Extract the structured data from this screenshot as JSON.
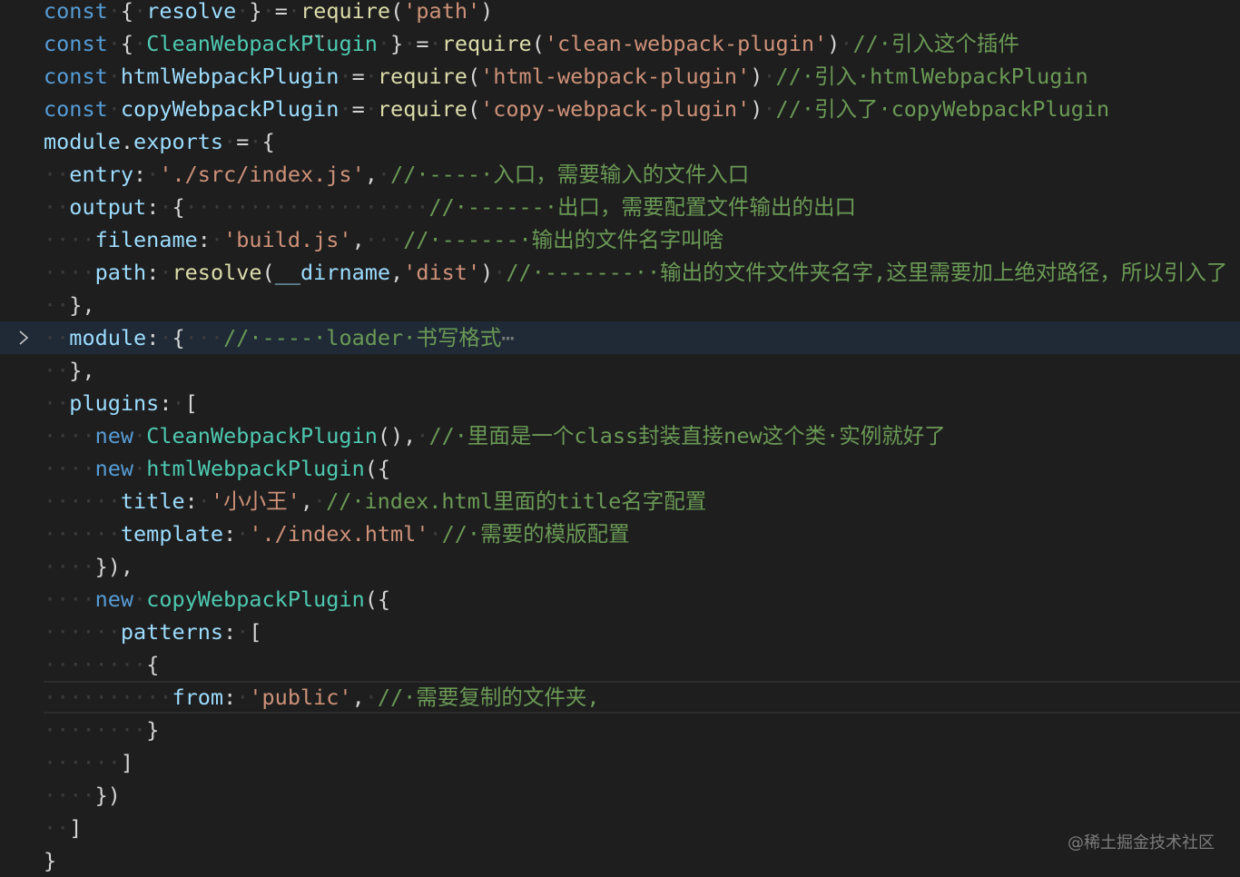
{
  "editor": {
    "lines": [
      [
        [
          "t-keyword",
          "const"
        ],
        [
          "t-ws",
          "·"
        ],
        [
          "t-punct",
          "{"
        ],
        [
          "t-ws",
          "·"
        ],
        [
          "t-var",
          "resolve"
        ],
        [
          "t-ws",
          "·"
        ],
        [
          "t-punct",
          "}"
        ],
        [
          "t-ws",
          "·"
        ],
        [
          "t-punct",
          "="
        ],
        [
          "t-ws",
          "·"
        ],
        [
          "t-func",
          "require"
        ],
        [
          "t-punct",
          "("
        ],
        [
          "t-string",
          "'path'"
        ],
        [
          "t-punct",
          ")"
        ]
      ],
      [
        [
          "t-keyword",
          "const"
        ],
        [
          "t-ws",
          "·"
        ],
        [
          "t-punct",
          "{"
        ],
        [
          "t-ws",
          "·"
        ],
        [
          "t-class",
          "CleanWebpackPlugin"
        ],
        [
          "t-ws",
          "·"
        ],
        [
          "t-punct",
          "}"
        ],
        [
          "t-ws",
          "·"
        ],
        [
          "t-punct",
          "="
        ],
        [
          "t-ws",
          "·"
        ],
        [
          "t-func",
          "require"
        ],
        [
          "t-punct",
          "("
        ],
        [
          "t-string",
          "'clean-webpack-plugin'"
        ],
        [
          "t-punct",
          ")"
        ],
        [
          "t-ws",
          "·"
        ],
        [
          "t-comment",
          "//·引入这个插件"
        ]
      ],
      [
        [
          "t-keyword",
          "const"
        ],
        [
          "t-ws",
          "·"
        ],
        [
          "t-var",
          "htmlWebpackPlugin"
        ],
        [
          "t-ws",
          "·"
        ],
        [
          "t-punct",
          "="
        ],
        [
          "t-ws",
          "·"
        ],
        [
          "t-func",
          "require"
        ],
        [
          "t-punct",
          "("
        ],
        [
          "t-string",
          "'html-webpack-plugin'"
        ],
        [
          "t-punct",
          ")"
        ],
        [
          "t-ws",
          "·"
        ],
        [
          "t-comment",
          "//·引入·htmlWebpackPlugin"
        ]
      ],
      [
        [
          "t-keyword",
          "const"
        ],
        [
          "t-ws",
          "·"
        ],
        [
          "t-var",
          "copyWebpackPlugin"
        ],
        [
          "t-ws",
          "·"
        ],
        [
          "t-punct",
          "="
        ],
        [
          "t-ws",
          "·"
        ],
        [
          "t-func",
          "require"
        ],
        [
          "t-punct",
          "("
        ],
        [
          "t-string",
          "'copy-webpack-plugin'"
        ],
        [
          "t-punct",
          ")"
        ],
        [
          "t-ws",
          "·"
        ],
        [
          "t-comment",
          "//·引入了·copyWebpackPlugin"
        ]
      ],
      [
        [
          "t-var",
          "module"
        ],
        [
          "t-punct",
          "."
        ],
        [
          "t-var",
          "exports"
        ],
        [
          "t-ws",
          "·"
        ],
        [
          "t-punct",
          "="
        ],
        [
          "t-ws",
          "·"
        ],
        [
          "t-punct",
          "{"
        ]
      ],
      [
        [
          "t-ws",
          "··"
        ],
        [
          "t-var",
          "entry"
        ],
        [
          "t-punct",
          ":"
        ],
        [
          "t-ws",
          "·"
        ],
        [
          "t-string",
          "'./src/index.js'"
        ],
        [
          "t-punct",
          ","
        ],
        [
          "t-ws",
          "·"
        ],
        [
          "t-comment",
          "//·----·入口，需要输入的文件入口"
        ]
      ],
      [
        [
          "t-ws",
          "··"
        ],
        [
          "t-var",
          "output"
        ],
        [
          "t-punct",
          ":"
        ],
        [
          "t-ws",
          "·"
        ],
        [
          "t-punct",
          "{"
        ],
        [
          "t-ws",
          "···················"
        ],
        [
          "t-comment",
          "//·------·出口，需要配置文件输出的出口"
        ]
      ],
      [
        [
          "t-ws",
          "····"
        ],
        [
          "t-var",
          "filename"
        ],
        [
          "t-punct",
          ":"
        ],
        [
          "t-ws",
          "·"
        ],
        [
          "t-string",
          "'build.js'"
        ],
        [
          "t-punct",
          ","
        ],
        [
          "t-ws",
          "···"
        ],
        [
          "t-comment",
          "//·------·输出的文件名字叫啥"
        ]
      ],
      [
        [
          "t-ws",
          "····"
        ],
        [
          "t-var",
          "path"
        ],
        [
          "t-punct",
          ":"
        ],
        [
          "t-ws",
          "·"
        ],
        [
          "t-func",
          "resolve"
        ],
        [
          "t-punct",
          "("
        ],
        [
          "t-var",
          "__dirname"
        ],
        [
          "t-punct",
          ","
        ],
        [
          "t-string",
          "'dist'"
        ],
        [
          "t-punct",
          ")"
        ],
        [
          "t-ws",
          "·"
        ],
        [
          "t-comment",
          "//·-------··输出的文件文件夹名字,这里需要加上绝对路径，所以引入了"
        ]
      ],
      [
        [
          "t-ws",
          "··"
        ],
        [
          "t-punct",
          "},"
        ]
      ],
      [
        [
          "t-ws",
          "··"
        ],
        [
          "t-var",
          "module"
        ],
        [
          "t-punct",
          ":"
        ],
        [
          "t-ws",
          "·"
        ],
        [
          "t-punct",
          "{"
        ],
        [
          "t-ws",
          "···"
        ],
        [
          "t-comment",
          "//·----·loader·书写格式"
        ],
        [
          "t-fold",
          "⋯"
        ]
      ],
      [
        [
          "t-ws",
          "··"
        ],
        [
          "t-punct",
          "},"
        ]
      ],
      [
        [
          "t-ws",
          "··"
        ],
        [
          "t-var",
          "plugins"
        ],
        [
          "t-punct",
          ":"
        ],
        [
          "t-ws",
          "·"
        ],
        [
          "t-punct",
          "["
        ]
      ],
      [
        [
          "t-ws",
          "····"
        ],
        [
          "t-keyword",
          "new"
        ],
        [
          "t-ws",
          "·"
        ],
        [
          "t-class",
          "CleanWebpackPlugin"
        ],
        [
          "t-punct",
          "(),"
        ],
        [
          "t-ws",
          "·"
        ],
        [
          "t-comment",
          "//·里面是一个class封装直接new这个类·实例就好了"
        ]
      ],
      [
        [
          "t-ws",
          "····"
        ],
        [
          "t-keyword",
          "new"
        ],
        [
          "t-ws",
          "·"
        ],
        [
          "t-class",
          "htmlWebpackPlugin"
        ],
        [
          "t-punct",
          "({"
        ]
      ],
      [
        [
          "t-ws",
          "······"
        ],
        [
          "t-var",
          "title"
        ],
        [
          "t-punct",
          ":"
        ],
        [
          "t-ws",
          "·"
        ],
        [
          "t-string",
          "'小小王'"
        ],
        [
          "t-punct",
          ","
        ],
        [
          "t-ws",
          "·"
        ],
        [
          "t-comment",
          "//·index.html里面的title名字配置"
        ]
      ],
      [
        [
          "t-ws",
          "······"
        ],
        [
          "t-var",
          "template"
        ],
        [
          "t-punct",
          ":"
        ],
        [
          "t-ws",
          "·"
        ],
        [
          "t-string",
          "'./index.html'"
        ],
        [
          "t-ws",
          "·"
        ],
        [
          "t-comment",
          "//·需要的模版配置"
        ]
      ],
      [
        [
          "t-ws",
          "····"
        ],
        [
          "t-punct",
          "}),"
        ]
      ],
      [
        [
          "t-ws",
          "····"
        ],
        [
          "t-keyword",
          "new"
        ],
        [
          "t-ws",
          "·"
        ],
        [
          "t-class",
          "copyWebpackPlugin"
        ],
        [
          "t-punct",
          "({"
        ]
      ],
      [
        [
          "t-ws",
          "······"
        ],
        [
          "t-var",
          "patterns"
        ],
        [
          "t-punct",
          ":"
        ],
        [
          "t-ws",
          "·"
        ],
        [
          "t-punct",
          "["
        ]
      ],
      [
        [
          "t-ws",
          "········"
        ],
        [
          "t-punct",
          "{"
        ]
      ],
      [
        [
          "t-ws",
          "··········"
        ],
        [
          "t-var",
          "from"
        ],
        [
          "t-punct",
          ":"
        ],
        [
          "t-ws",
          "·"
        ],
        [
          "t-string",
          "'public'"
        ],
        [
          "t-punct",
          ","
        ],
        [
          "t-ws",
          "·"
        ],
        [
          "t-comment",
          "//·需要复制的文件夹,"
        ]
      ],
      [
        [
          "t-ws",
          "········"
        ],
        [
          "t-punct",
          "}"
        ]
      ],
      [
        [
          "t-ws",
          "······"
        ],
        [
          "t-punct",
          "]"
        ]
      ],
      [
        [
          "t-ws",
          "····"
        ],
        [
          "t-punct",
          "})"
        ]
      ],
      [
        [
          "t-ws",
          "··"
        ],
        [
          "t-punct",
          "]"
        ]
      ],
      [
        [
          "t-punct",
          "}"
        ]
      ]
    ],
    "collapsed_line": 10,
    "current_line": 21
  },
  "icons": {
    "fold": "chevron-right-icon",
    "warning": "squiggle-underline-icon"
  },
  "colors": {
    "background": "#1e1e1e",
    "keyword": "#569cd6",
    "variable": "#9cdcfe",
    "class": "#4ec9b0",
    "function": "#dcdcaa",
    "string": "#ce9178",
    "comment": "#6a9955",
    "punctuation": "#d4d4d4",
    "whitespace_marker": "#3b3b3b"
  },
  "watermark": {
    "text": "@稀土掘金技术社区"
  }
}
